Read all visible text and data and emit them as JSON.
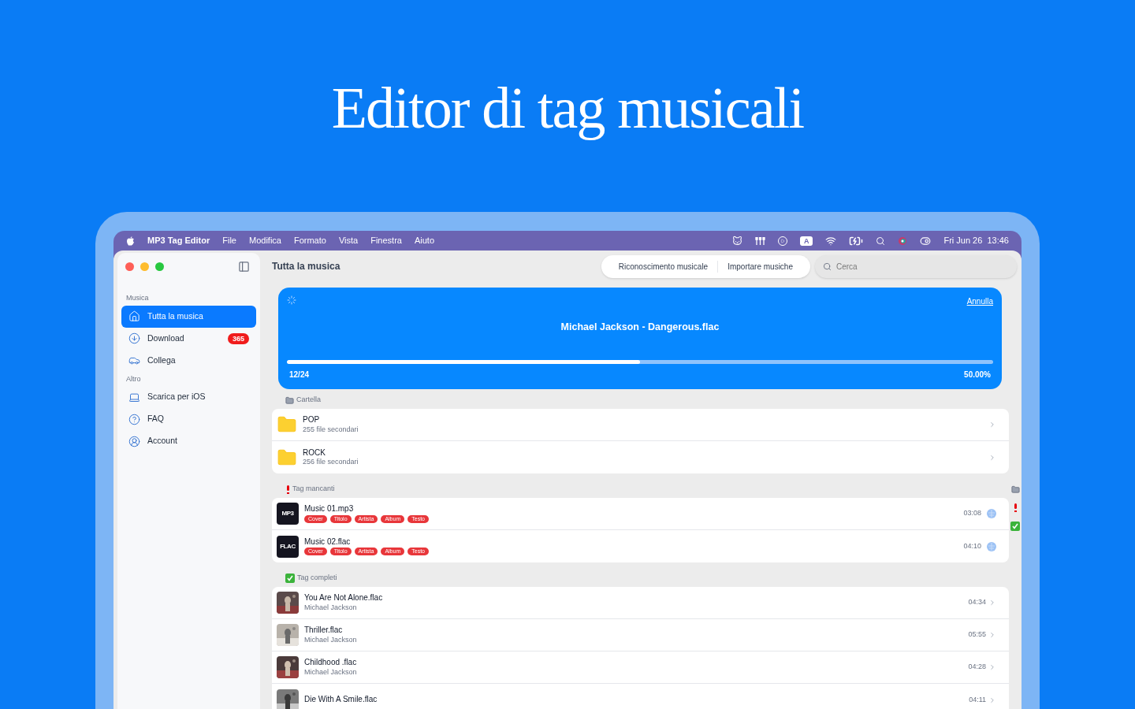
{
  "headline": "Editor di tag musicali",
  "menu_bar": {
    "app_name": "MP3 Tag Editor",
    "menus": [
      "File",
      "Modifica",
      "Formato",
      "Vista",
      "Finestra",
      "Aiuto"
    ],
    "input_source": "A",
    "clock": "Fri Jun 26  13:46"
  },
  "sidebar": {
    "sections": [
      {
        "title": "Musica",
        "items": [
          {
            "label": "Tutta la musica",
            "selected": true
          },
          {
            "label": "Download",
            "selected": false,
            "badge": "365"
          },
          {
            "label": "Collega",
            "selected": false
          }
        ]
      },
      {
        "title": "Altro",
        "items": [
          {
            "label": "Scarica per iOS",
            "selected": false
          },
          {
            "label": "FAQ",
            "selected": false
          },
          {
            "label": "Account",
            "selected": false
          }
        ]
      }
    ]
  },
  "header": {
    "title": "Tutta la musica",
    "buttons": [
      "Riconoscimento musicale",
      "Importare musiche"
    ],
    "search": {
      "placeholder": "Cerca"
    }
  },
  "progress_card": {
    "cancel": "Annulla",
    "file": "Michael Jackson - Dangerous.flac",
    "level": 0.5,
    "count": "12/24",
    "percent": "50.00%"
  },
  "sections": [
    {
      "kind": "folders",
      "title": "Cartella",
      "rows": [
        {
          "name": "POP",
          "detail": "255 file secondari"
        },
        {
          "name": "ROCK",
          "detail": "256 file secondari"
        }
      ]
    },
    {
      "kind": "missing",
      "title": "Tag mancanti",
      "rows": [
        {
          "name": "Music 01.mp3",
          "format": "MP3",
          "tags": [
            "Cover",
            "Titolo",
            "Artista",
            "Album",
            "Testo"
          ],
          "duration": "03:08"
        },
        {
          "name": "Music 02.flac",
          "format": "FLAC",
          "tags": [
            "Cover",
            "Titolo",
            "Artista",
            "Album",
            "Testo"
          ],
          "duration": "04:10"
        }
      ]
    },
    {
      "kind": "complete",
      "title": "Tag completi",
      "rows": [
        {
          "name": "You Are Not Alone.flac",
          "detail": "Michael Jackson",
          "duration": "04:34"
        },
        {
          "name": "Thriller.flac",
          "detail": "Michael Jackson",
          "duration": "05:55"
        },
        {
          "name": "Childhood .flac",
          "detail": "Michael Jackson",
          "duration": "04:28"
        },
        {
          "name": "Die With A Smile.flac",
          "duration": "04:11"
        }
      ]
    }
  ]
}
